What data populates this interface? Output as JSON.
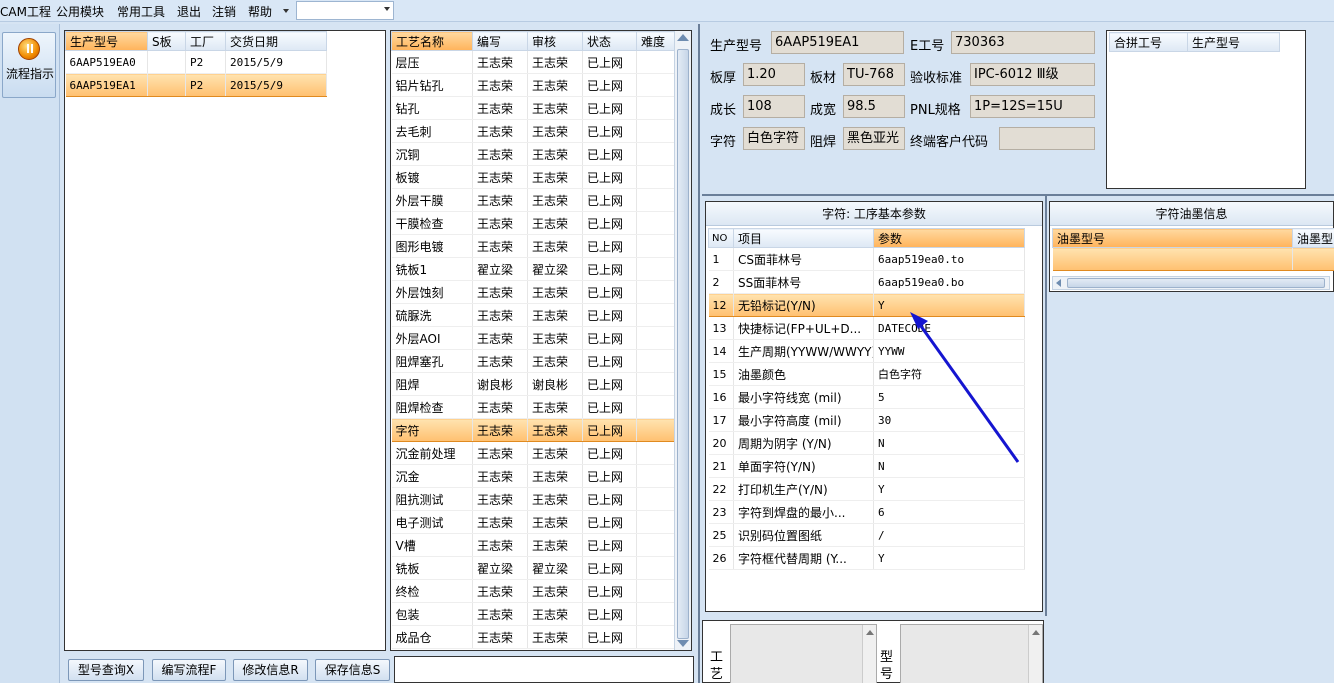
{
  "menu": {
    "items": [
      "CAM工程",
      "公用模块",
      "常用工具",
      "退出",
      "注销",
      "帮助"
    ]
  },
  "nav": {
    "flow_label": "流程指示"
  },
  "products": {
    "headers": [
      "生产型号",
      "S板",
      "工厂",
      "交货日期"
    ],
    "rows": [
      {
        "model": "6AAP519EA0",
        "s": "",
        "factory": "P2",
        "date": "2015/5/9"
      },
      {
        "model": "6AAP519EA1",
        "s": "",
        "factory": "P2",
        "date": "2015/5/9"
      }
    ]
  },
  "process": {
    "headers": [
      "工艺名称",
      "编写",
      "审核",
      "状态",
      "难度"
    ],
    "rows": [
      [
        "层压",
        "王志荣",
        "王志荣",
        "已上网",
        ""
      ],
      [
        "铝片钻孔",
        "王志荣",
        "王志荣",
        "已上网",
        ""
      ],
      [
        "钻孔",
        "王志荣",
        "王志荣",
        "已上网",
        ""
      ],
      [
        "去毛刺",
        "王志荣",
        "王志荣",
        "已上网",
        ""
      ],
      [
        "沉铜",
        "王志荣",
        "王志荣",
        "已上网",
        ""
      ],
      [
        "板镀",
        "王志荣",
        "王志荣",
        "已上网",
        ""
      ],
      [
        "外层干膜",
        "王志荣",
        "王志荣",
        "已上网",
        ""
      ],
      [
        "干膜检查",
        "王志荣",
        "王志荣",
        "已上网",
        ""
      ],
      [
        "图形电镀",
        "王志荣",
        "王志荣",
        "已上网",
        ""
      ],
      [
        "铣板1",
        "翟立梁",
        "翟立梁",
        "已上网",
        ""
      ],
      [
        "外层蚀刻",
        "王志荣",
        "王志荣",
        "已上网",
        ""
      ],
      [
        "硫脲洗",
        "王志荣",
        "王志荣",
        "已上网",
        ""
      ],
      [
        "外层AOI",
        "王志荣",
        "王志荣",
        "已上网",
        ""
      ],
      [
        "阻焊塞孔",
        "王志荣",
        "王志荣",
        "已上网",
        ""
      ],
      [
        "阻焊",
        "谢良彬",
        "谢良彬",
        "已上网",
        ""
      ],
      [
        "阻焊检查",
        "王志荣",
        "王志荣",
        "已上网",
        ""
      ],
      [
        "字符",
        "王志荣",
        "王志荣",
        "已上网",
        ""
      ],
      [
        "沉金前处理",
        "王志荣",
        "王志荣",
        "已上网",
        ""
      ],
      [
        "沉金",
        "王志荣",
        "王志荣",
        "已上网",
        ""
      ],
      [
        "阻抗测试",
        "王志荣",
        "王志荣",
        "已上网",
        ""
      ],
      [
        "电子测试",
        "王志荣",
        "王志荣",
        "已上网",
        ""
      ],
      [
        "V槽",
        "王志荣",
        "王志荣",
        "已上网",
        ""
      ],
      [
        "铣板",
        "翟立梁",
        "翟立梁",
        "已上网",
        ""
      ],
      [
        "终检",
        "王志荣",
        "王志荣",
        "已上网",
        ""
      ],
      [
        "包装",
        "王志荣",
        "王志荣",
        "已上网",
        ""
      ],
      [
        "成品仓",
        "王志荣",
        "王志荣",
        "已上网",
        ""
      ]
    ],
    "selected_index": 16
  },
  "buttons": {
    "query": "型号查询X",
    "write": "编写流程F",
    "modify": "修改信息R",
    "save": "保存信息S"
  },
  "info": {
    "model_label": "生产型号",
    "model_value": "6AAP519EA1",
    "e_label": "E工号",
    "e_value": "730363",
    "thick_label": "板厚",
    "thick_value": "1.20",
    "mat_label": "板材",
    "mat_value": "TU-768",
    "std_label": "验收标准",
    "std_value": "IPC-6012 Ⅲ级",
    "len_label": "成长",
    "len_value": "108",
    "wid_label": "成宽",
    "wid_value": "98.5",
    "pnl_label": "PNL规格",
    "pnl_value": "1P=12S=15U",
    "char_label": "字符",
    "char_value": "白色字符",
    "mask_label": "阻焊",
    "mask_value": "黑色亚光",
    "cust_label": "终端客户代码",
    "cust_value": ""
  },
  "merge": {
    "headers": [
      "合拼工号",
      "生产型号"
    ]
  },
  "params": {
    "title": "字符: 工序基本参数",
    "headers": [
      "NO",
      "项目",
      "参数"
    ],
    "rows": [
      [
        "1",
        "CS面菲林号",
        "6aap519ea0.to"
      ],
      [
        "2",
        "SS面菲林号",
        "6aap519ea0.bo"
      ],
      [
        "12",
        "无铅标记(Y/N)",
        "Y"
      ],
      [
        "13",
        "快捷标记(FP+UL+D...",
        "DATECODE"
      ],
      [
        "14",
        "生产周期(YYWW/WWYY)",
        "YYWW"
      ],
      [
        "15",
        "油墨颜色",
        "白色字符"
      ],
      [
        "16",
        "最小字符线宽 (mil)",
        "5"
      ],
      [
        "17",
        "最小字符高度 (mil)",
        "30"
      ],
      [
        "20",
        "周期为阴字 (Y/N)",
        "N"
      ],
      [
        "21",
        "单面字符(Y/N)",
        "N"
      ],
      [
        "22",
        "打印机生产(Y/N)",
        "Y"
      ],
      [
        "23",
        "字符到焊盘的最小...",
        "6"
      ],
      [
        "25",
        "识别码位置图纸",
        "/"
      ],
      [
        "26",
        "字符框代替周期 (Y...",
        "Y"
      ]
    ],
    "selected_index": 2
  },
  "ink": {
    "title": "字符油墨信息",
    "headers": [
      "油墨型号",
      "油墨型"
    ]
  },
  "bottom": {
    "left_label": "工艺",
    "right_label": "型号"
  }
}
